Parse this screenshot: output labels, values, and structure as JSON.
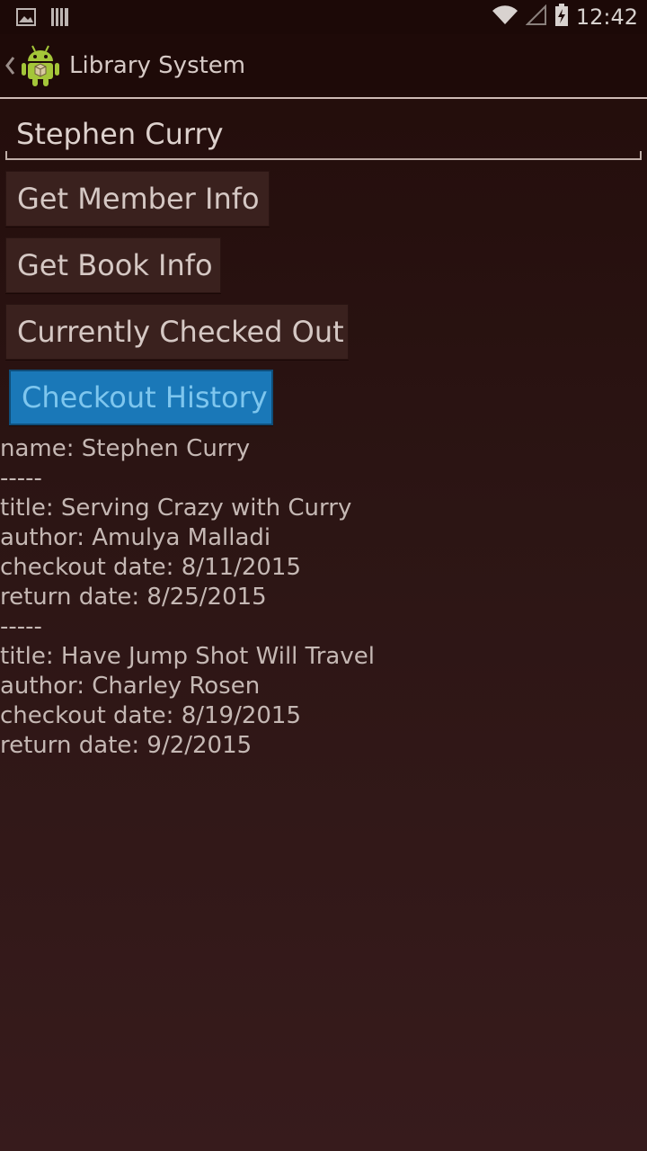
{
  "status_bar": {
    "time": "12:42",
    "icons": [
      "gallery-icon",
      "barcode-icon",
      "wifi-icon",
      "signal-icon",
      "battery-charging-icon"
    ]
  },
  "action_bar": {
    "title": "Library System",
    "icons": [
      "back-chevron-icon",
      "android-logo-icon"
    ]
  },
  "name_input": {
    "value": "Stephen Curry"
  },
  "buttons": {
    "member_info": "Get Member Info",
    "book_info": "Get Book Info",
    "checked_out": "Currently Checked Out",
    "history": "Checkout History"
  },
  "output": {
    "lines": [
      "name: Stephen Curry",
      "-----",
      "title: Serving Crazy with Curry",
      "author: Amulya Malladi",
      "checkout date: 8/11/2015",
      "return date: 8/25/2015",
      "-----",
      "title: Have Jump Shot Will Travel",
      "author: Charley Rosen",
      "checkout date: 8/19/2015",
      "return date: 9/2/2015"
    ]
  },
  "colors": {
    "background_top": "#220c0a",
    "background_bottom": "#371b1c",
    "button_bg": "#3a211e",
    "active_button_bg": "#1a78b8",
    "active_button_text": "#7ec6ee"
  }
}
